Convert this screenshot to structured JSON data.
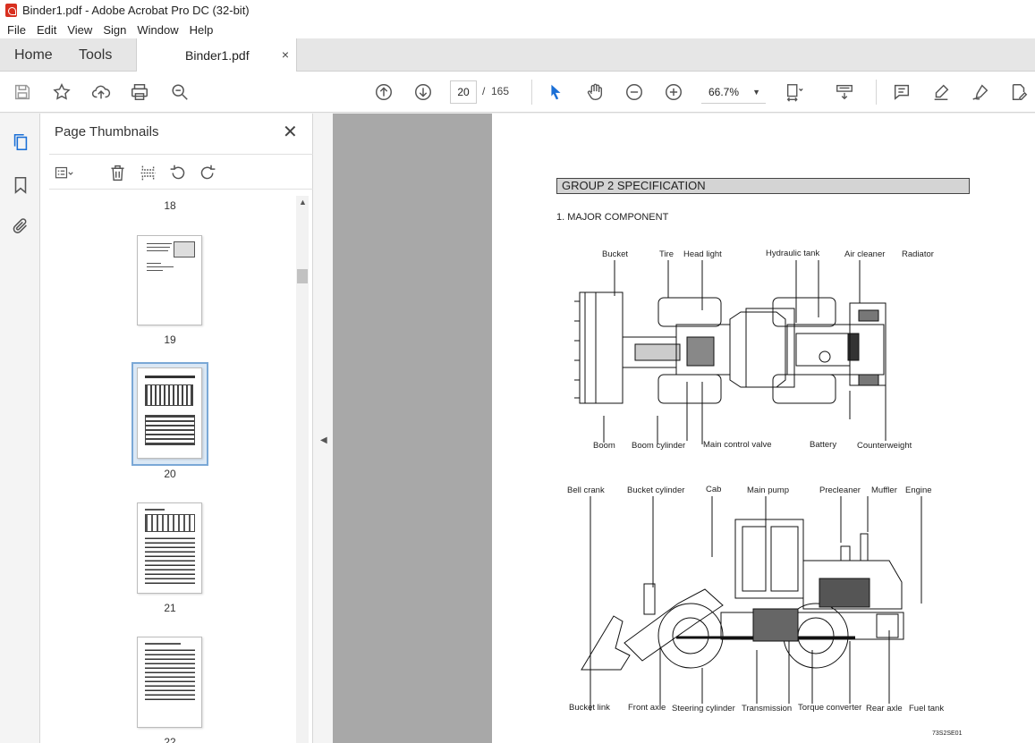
{
  "window": {
    "title": "Binder1.pdf - Adobe Acrobat Pro DC (32-bit)"
  },
  "menu": [
    "File",
    "Edit",
    "View",
    "Sign",
    "Window",
    "Help"
  ],
  "tabs": {
    "home": "Home",
    "tools": "Tools",
    "document": "Binder1.pdf",
    "close": "×"
  },
  "toolbar": {
    "current_page": "20",
    "separator": "/",
    "total_pages": "165",
    "zoom": "66.7%"
  },
  "panel": {
    "title": "Page Thumbnails",
    "close": "✕",
    "thumbnails": [
      {
        "label": "18"
      },
      {
        "label": "19"
      },
      {
        "label": "20",
        "selected": true
      },
      {
        "label": "21"
      },
      {
        "label": "22"
      }
    ]
  },
  "document": {
    "group_title": "GROUP  2  SPECIFICATION",
    "section_title": "1. MAJOR COMPONENT",
    "top_labels": {
      "bucket": "Bucket",
      "tire": "Tire",
      "head_light": "Head light",
      "hydraulic_tank": "Hydraulic tank",
      "air_cleaner": "Air cleaner",
      "radiator": "Radiator",
      "boom": "Boom",
      "boom_cylinder": "Boom cylinder",
      "main_control_valve": "Main control valve",
      "battery": "Battery",
      "counterweight": "Counterweight"
    },
    "side_labels": {
      "bell_crank": "Bell crank",
      "bucket_cylinder": "Bucket cylinder",
      "cab": "Cab",
      "main_pump": "Main pump",
      "precleaner": "Precleaner",
      "muffler": "Muffler",
      "engine": "Engine",
      "bucket_link": "Bucket link",
      "front_axle": "Front axle",
      "steering_cylinder": "Steering cylinder",
      "transmission": "Transmission",
      "torque_converter": "Torque converter",
      "rear_axle": "Rear axle",
      "fuel_tank": "Fuel tank"
    },
    "figure_code": "73S2SE01"
  }
}
